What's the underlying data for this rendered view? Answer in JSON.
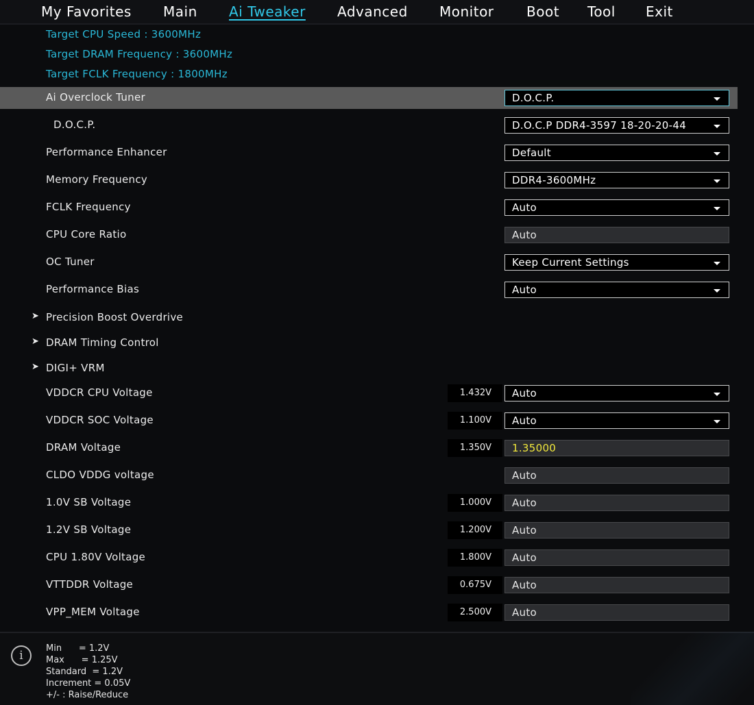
{
  "nav": {
    "tabs": [
      {
        "label": "My Favorites"
      },
      {
        "label": "Main"
      },
      {
        "label": "Ai Tweaker"
      },
      {
        "label": "Advanced"
      },
      {
        "label": "Monitor"
      },
      {
        "label": "Boot"
      },
      {
        "label": "Tool"
      },
      {
        "label": "Exit"
      }
    ],
    "active": "Ai Tweaker"
  },
  "targets": [
    "Target CPU Speed : 3600MHz",
    "Target DRAM Frequency : 3600MHz",
    "Target FCLK Frequency : 1800MHz"
  ],
  "settings": [
    {
      "label": "Ai Overclock Tuner",
      "value": "D.O.C.P.",
      "type": "select"
    },
    {
      "label": "D.O.C.P.",
      "value": "D.O.C.P DDR4-3597 18-20-20-44",
      "type": "select"
    },
    {
      "label": "Performance Enhancer",
      "value": "Default",
      "type": "select"
    },
    {
      "label": "Memory Frequency",
      "value": "DDR4-3600MHz",
      "type": "select"
    },
    {
      "label": "FCLK Frequency",
      "value": "Auto",
      "type": "select"
    },
    {
      "label": "CPU Core Ratio",
      "value": "Auto",
      "type": "text"
    },
    {
      "label": "OC Tuner",
      "value": "Keep Current Settings",
      "type": "select"
    },
    {
      "label": "Performance Bias",
      "value": "Auto",
      "type": "select"
    }
  ],
  "submenus": [
    {
      "label": "Precision Boost Overdrive"
    },
    {
      "label": "DRAM Timing Control"
    },
    {
      "label": "DIGI+ VRM"
    }
  ],
  "voltages": [
    {
      "label": "VDDCR CPU Voltage",
      "reading": "1.432V",
      "value": "Auto",
      "type": "select"
    },
    {
      "label": "VDDCR SOC Voltage",
      "reading": "1.100V",
      "value": "Auto",
      "type": "select"
    },
    {
      "label": "DRAM Voltage",
      "reading": "1.350V",
      "value": "1.35000",
      "type": "text"
    },
    {
      "label": "CLDO VDDG voltage",
      "reading": "",
      "value": "Auto",
      "type": "text"
    },
    {
      "label": "1.0V SB Voltage",
      "reading": "1.000V",
      "value": "Auto",
      "type": "text"
    },
    {
      "label": "1.2V SB Voltage",
      "reading": "1.200V",
      "value": "Auto",
      "type": "text"
    },
    {
      "label": "CPU 1.80V Voltage",
      "reading": "1.800V",
      "value": "Auto",
      "type": "text"
    },
    {
      "label": "VTTDDR Voltage",
      "reading": "0.675V",
      "value": "Auto",
      "type": "text"
    },
    {
      "label": "VPP_MEM Voltage",
      "reading": "2.500V",
      "value": "Auto",
      "type": "text"
    }
  ],
  "help": {
    "icon": "info-icon",
    "lines": [
      "Min      = 1.2V",
      "Max      = 1.25V",
      "Standard  = 1.2V",
      "Increment = 0.05V",
      "+/- : Raise/Reduce"
    ]
  },
  "colors": {
    "accent": "#31c8e8",
    "info_text": "#2ab9d8",
    "highlight_row": "#5a5a5a",
    "edited_value": "#f1e83c"
  }
}
